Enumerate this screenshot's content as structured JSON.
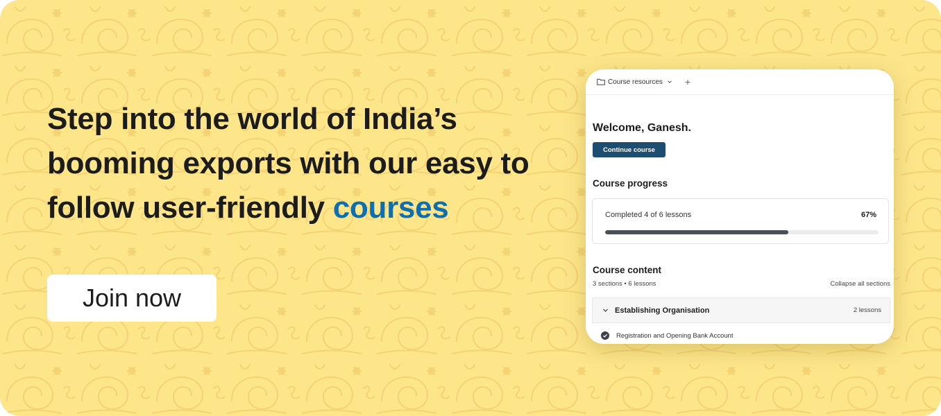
{
  "banner": {
    "headline_main": "Step into the world of India’s booming exports with our easy to follow user-friendly ",
    "headline_accent": "courses",
    "join_label": "Join now",
    "background_color": "#fde58a",
    "accent_color": "#0d6fb0"
  },
  "app": {
    "tab_label": "Course resources",
    "tab_icon": "folder-icon",
    "add_tab_icon": "plus-icon",
    "add_tab_glyph": "+",
    "welcome": "Welcome, Ganesh.",
    "continue_label": "Continue course",
    "primary_color": "#1d4e72",
    "progress": {
      "title": "Course progress",
      "text": "Completed 4 of 6 lessons",
      "percent_label": "67%",
      "fraction": 0.67
    },
    "content": {
      "title": "Course content",
      "summary": "3 sections • 6 lessons",
      "collapse_label": "Collapse all sections",
      "sections": [
        {
          "name": "Establishing Organisation",
          "count": "2 lessons",
          "expanded": true,
          "lessons": [
            {
              "label": "Registration and Opening Bank Account",
              "completed": true
            }
          ]
        }
      ]
    }
  }
}
